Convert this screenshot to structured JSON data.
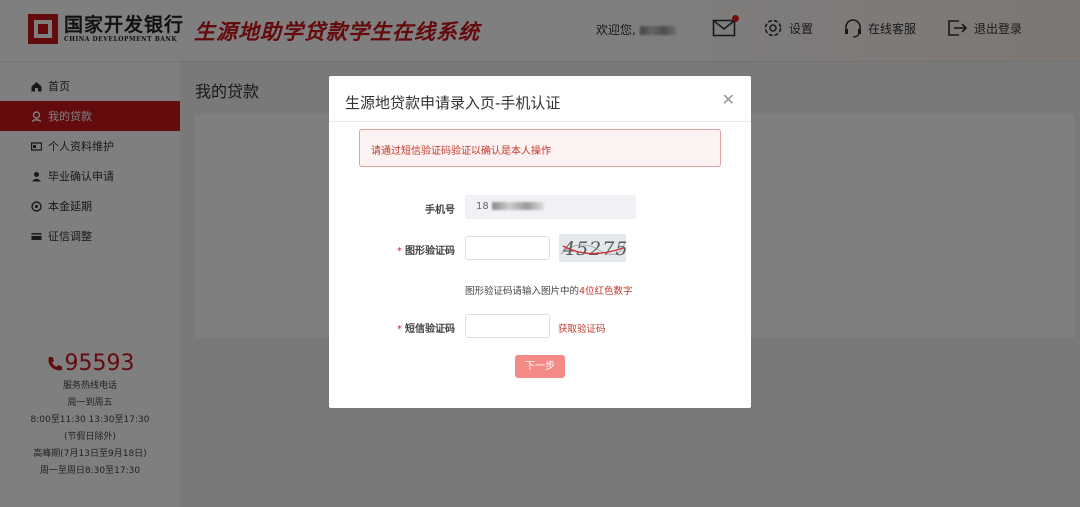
{
  "header": {
    "bank_name_cn": "国家开发银行",
    "bank_name_en": "CHINA DEVELOPMENT BANK",
    "system_title": "生源地助学贷款学生在线系统",
    "welcome": "欢迎您,",
    "settings": "设置",
    "online_service": "在线客服",
    "logout": "退出登录",
    "mail_has_unread": true
  },
  "sidebar": {
    "items": [
      {
        "label": "首页",
        "icon": "home-icon"
      },
      {
        "label": "我的贷款",
        "icon": "loan-icon",
        "active": true
      },
      {
        "label": "个人资料维护",
        "icon": "id-card-icon"
      },
      {
        "label": "毕业确认申请",
        "icon": "user-icon"
      },
      {
        "label": "本金延期",
        "icon": "clock-icon"
      },
      {
        "label": "征信调整",
        "icon": "card-icon"
      }
    ],
    "hotline": {
      "number": "95593",
      "label": "服务热线电话",
      "days": "周一到周五",
      "hours": "8:00至11:30 13:30至17:30",
      "holiday_note": "(节假日除外)",
      "peak": "高峰期(7月13日至9月18日)",
      "peak_hours": "周一至周日8:30至17:30"
    }
  },
  "main": {
    "page_title": "我的贷款"
  },
  "dialog": {
    "title": "生源地贷款申请录入页-手机认证",
    "alert": "请通过短信验证码验证以确认是本人操作",
    "phone_label": "手机号",
    "phone_value": "18",
    "captcha_label": "图形验证码",
    "captcha_image_text": "45275",
    "captcha_hint_prefix": "图形验证码请输入图片中的",
    "captcha_hint_red": "4位红色数字",
    "sms_label": "短信验证码",
    "sms_link": "获取验证码",
    "next_button": "下一步"
  },
  "colors": {
    "brand_red": "#c8161d",
    "button_pink": "#f48a87",
    "alert_text": "#c0392b"
  }
}
